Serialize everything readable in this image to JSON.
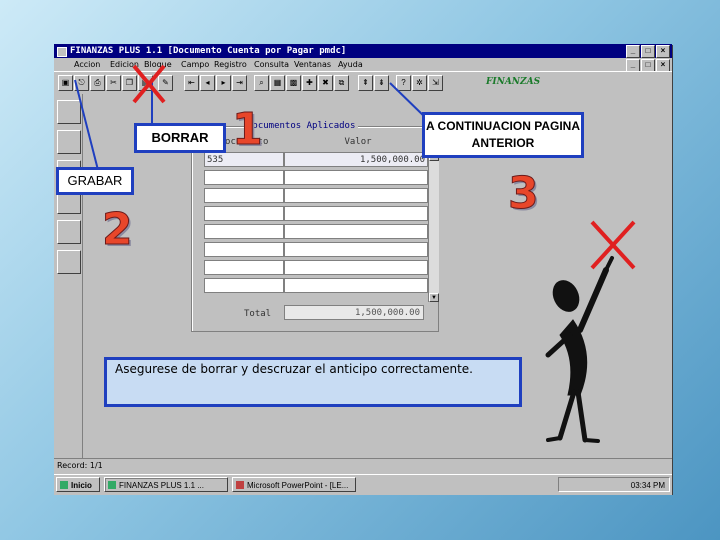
{
  "window": {
    "title": "FINANZAS PLUS 1.1   [Documento Cuenta por Pagar  pmdc]",
    "controls": [
      "_",
      "□",
      "×"
    ]
  },
  "menu": {
    "items": [
      "Accion",
      "Edicion",
      "Bloque",
      "Campo",
      "Registro",
      "Consulta",
      "Ventanas",
      "Ayuda"
    ]
  },
  "toolbar": {
    "logo_text": "FINANZAS"
  },
  "form": {
    "section_title": "Documentos Aplicados",
    "columns": [
      "Documento",
      "Valor"
    ],
    "rows": [
      {
        "doc": "535",
        "valor": "1,500,000.00"
      },
      {
        "doc": "",
        "valor": ""
      },
      {
        "doc": "",
        "valor": ""
      },
      {
        "doc": "",
        "valor": ""
      },
      {
        "doc": "",
        "valor": ""
      },
      {
        "doc": "",
        "valor": ""
      },
      {
        "doc": "",
        "valor": ""
      },
      {
        "doc": "",
        "valor": ""
      }
    ],
    "total_label": "Total",
    "total_value": "1,500,000.00"
  },
  "status": {
    "record": "Record: 1/1"
  },
  "taskbar": {
    "start": "Inicio",
    "tasks": [
      "FINANZAS PLUS 1.1 ...",
      "Microsoft PowerPoint - [LE..."
    ],
    "clock": "03:34 PM"
  },
  "annotations": {
    "borrar": "BORRAR",
    "grabar": "GRABAR",
    "continuacion": "A CONTINUACION PAGINA ANTERIOR",
    "num1": "1",
    "num2": "2",
    "num3": "3",
    "message": "Asegurese de borrar y descruzar el anticipo correctamente."
  },
  "colors": {
    "callout_border": "#1f3fbf",
    "number_fill": "#e8462a",
    "x_mark": "#e02020"
  }
}
